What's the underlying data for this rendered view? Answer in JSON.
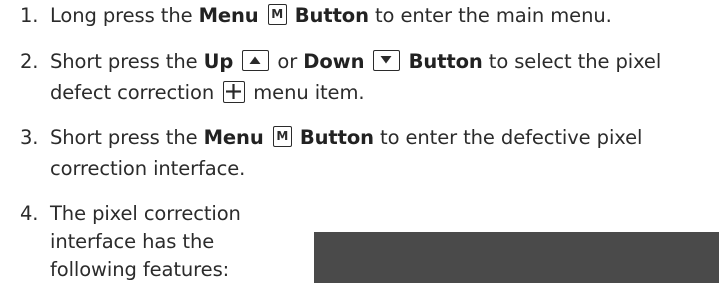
{
  "steps": [
    {
      "number": "1.",
      "lines": [
        [
          "Long press the ",
          "Menu",
          "M-key",
          "Button",
          " to enter the main menu."
        ]
      ]
    },
    {
      "number": "2.",
      "lines": [
        [
          "Short press the ",
          "Up",
          "up-key",
          " or ",
          "Down",
          "down-key",
          "Button",
          " to select the pixel"
        ],
        [
          "defect correction ",
          "plus-key",
          " menu item."
        ]
      ]
    },
    {
      "number": "3.",
      "lines": [
        [
          "Short press the ",
          "Menu",
          "M-key",
          "Button",
          " to enter the defective pixel"
        ],
        [
          "correction interface."
        ]
      ]
    },
    {
      "number": "4.",
      "lines": [
        [
          "The pixel correction"
        ],
        [
          "interface has the"
        ],
        [
          "following features:"
        ]
      ]
    }
  ],
  "text": {
    "s1_a": "Long press the ",
    "s1_menu": "Menu",
    "s1_key": "M",
    "s1_button": "Button",
    "s1_b": " to enter the main menu.",
    "s2_a": "Short press the ",
    "s2_up": "Up",
    "s2_or": " or ",
    "s2_down": "Down",
    "s2_button": "Button",
    "s2_b": " to select the pixel",
    "s2_c": "defect correction ",
    "s2_d": " menu item.",
    "s3_a": "Short press the ",
    "s3_menu": "Menu",
    "s3_key": "M",
    "s3_button": "Button",
    "s3_b": " to enter the defective pixel",
    "s3_c": "correction interface.",
    "s4_a": "The pixel correction",
    "s4_b": "interface has the",
    "s4_c": "following features:",
    "n1": "1.",
    "n2": "2.",
    "n3": "3.",
    "n4": "4."
  },
  "icons": {
    "menu_key": "menu-m-key-icon",
    "up_key": "up-arrow-key-icon",
    "down_key": "down-arrow-key-icon",
    "pixel_correction": "plus-box-icon"
  },
  "colors": {
    "text": "#2b2b2b",
    "screen": "#4a4a4a"
  }
}
